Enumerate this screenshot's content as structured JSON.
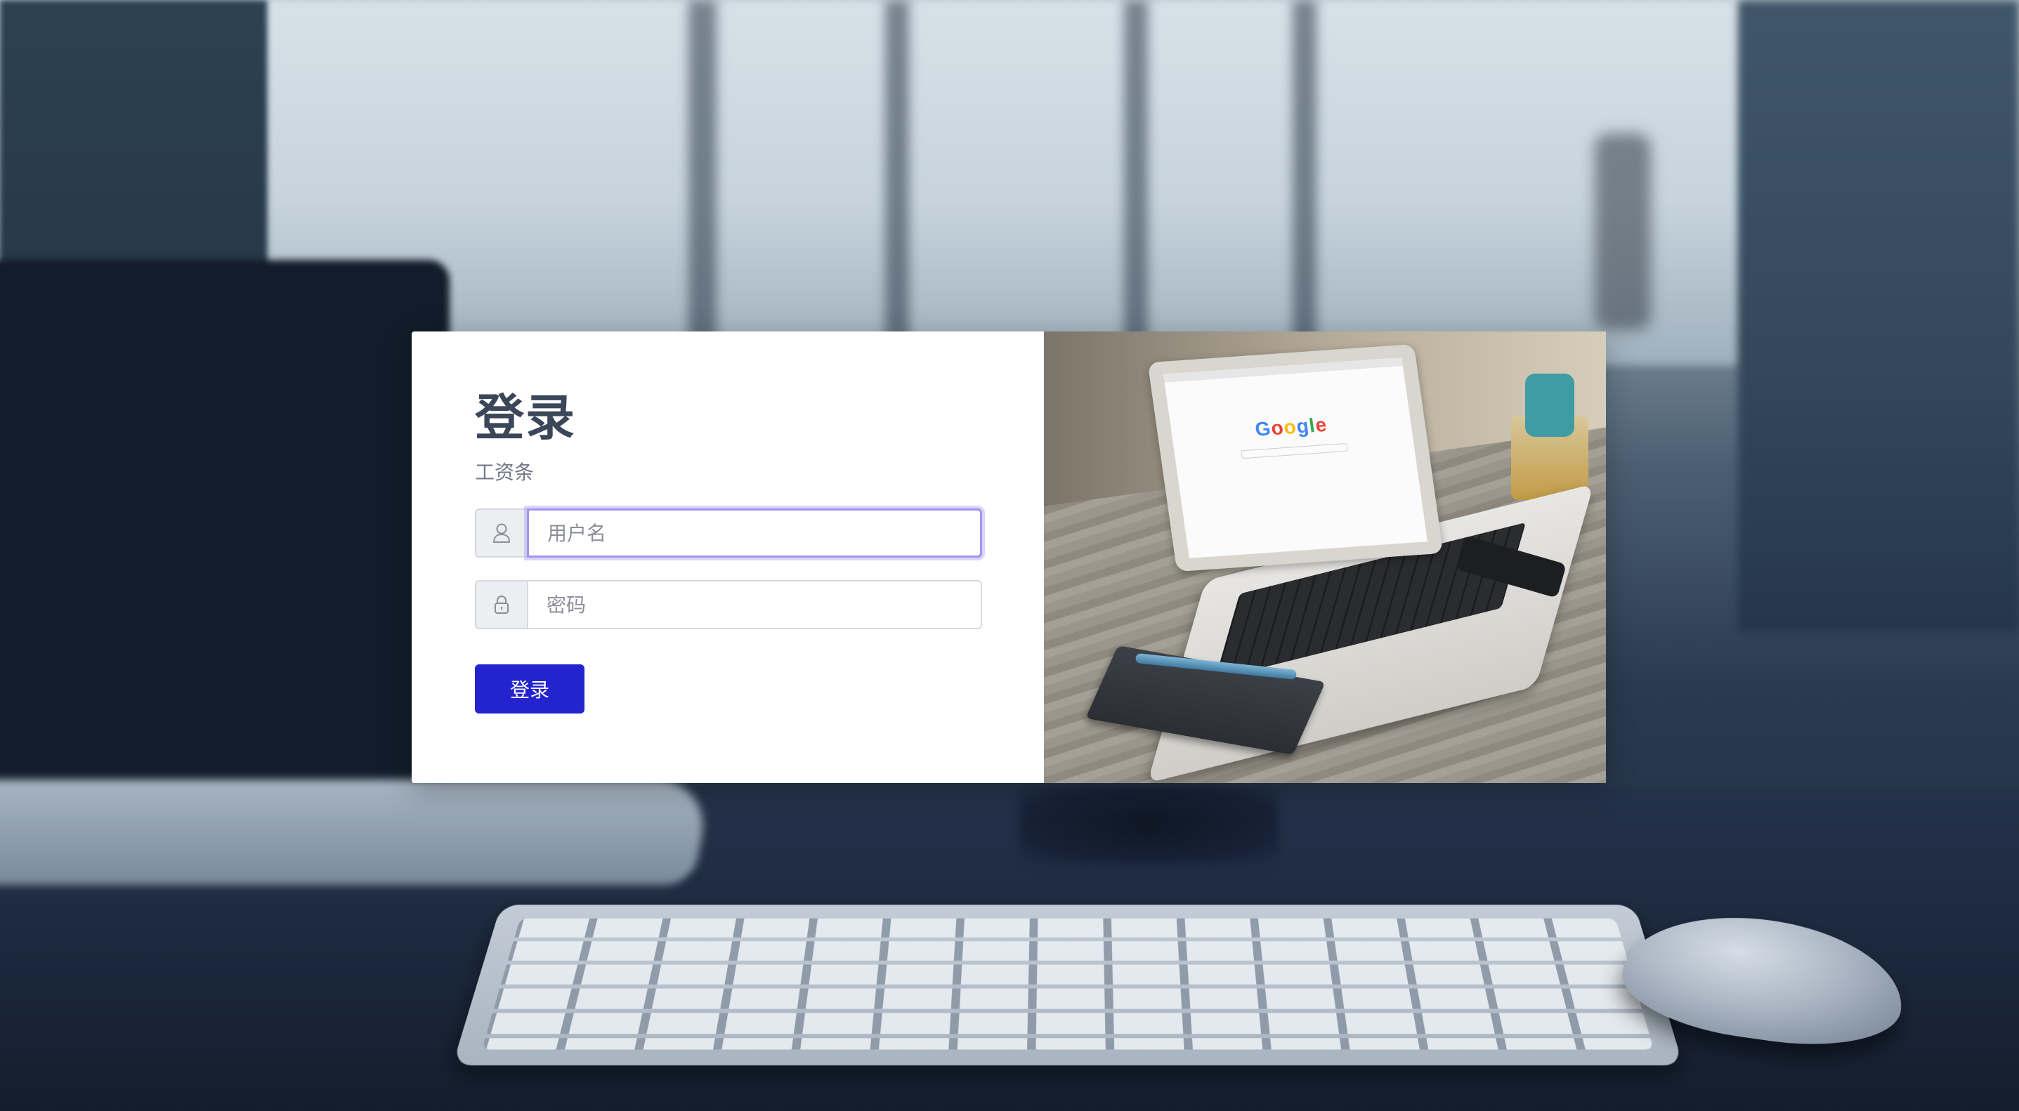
{
  "login": {
    "title": "登录",
    "subtitle": "工资条",
    "username": {
      "placeholder": "用户名",
      "value": "",
      "icon": "user-icon",
      "focused": true
    },
    "password": {
      "placeholder": "密码",
      "value": "",
      "icon": "lock-icon"
    },
    "submit_label": "登录"
  },
  "photo": {
    "screen_logo": "Google"
  },
  "colors": {
    "primary_button": "#2424cf",
    "title_text": "#3b4659",
    "subtitle_text": "#74798a",
    "focus_ring": "#9f94f0",
    "card_background": "#ffffff"
  }
}
